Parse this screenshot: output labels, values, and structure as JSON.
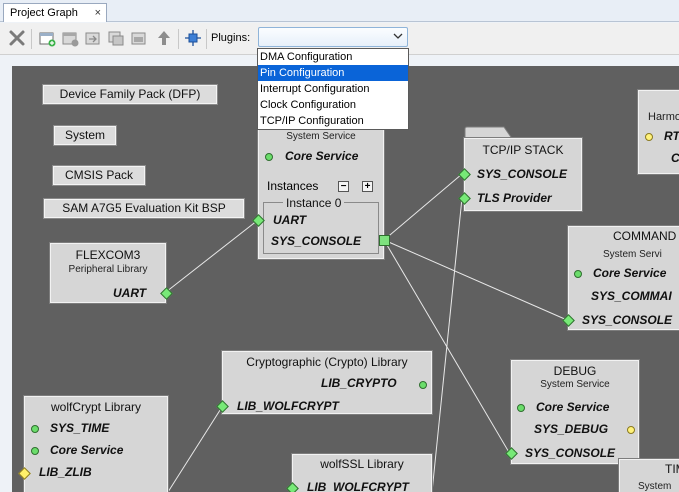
{
  "tab": {
    "title": "Project Graph",
    "close_glyph": "×"
  },
  "toolbar": {
    "plugins_label": "Plugins:",
    "plugins_value": "",
    "icons": [
      "delete-icon",
      "add-group-icon",
      "remove-group-icon",
      "move-to-group-icon",
      "copy-icon",
      "paste-icon",
      "move-up-icon",
      "auto-layout-icon"
    ]
  },
  "plugins_dropdown": {
    "options": [
      "DMA Configuration",
      "Pin Configuration",
      "Interrupt Configuration",
      "Clock Configuration",
      "TCP/IP Configuration"
    ],
    "selected_index": 1
  },
  "canvas": {
    "pills": [
      "Device Family Pack (DFP)",
      "System",
      "CMSIS Pack",
      "SAM A7G5 Evaluation Kit BSP"
    ],
    "core": {
      "subtitle": "System Service",
      "port_core": "Core Service",
      "instances_label": "Instances",
      "minus": "−",
      "plus": "+",
      "instance_label": "Instance 0",
      "port_uart": "UART",
      "port_console": "SYS_CONSOLE"
    },
    "flexcom": {
      "title": "FLEXCOM3",
      "subtitle": "Peripheral Library",
      "port": "UART"
    },
    "tcpip": {
      "title": "TCP/IP STACK",
      "port1": "SYS_CONSOLE",
      "port2": "TLS Provider"
    },
    "harmony": {
      "title": "Harmo",
      "port": "RT",
      "port2": "C"
    },
    "command": {
      "title": "COMMAND",
      "subtitle": "System Servi",
      "port1": "Core Service",
      "port2": "SYS_COMMAI",
      "port3": "SYS_CONSOLE"
    },
    "crypto": {
      "title": "Cryptographic (Crypto) Library",
      "port1": "LIB_CRYPTO",
      "port2": "LIB_WOLFCRYPT"
    },
    "debug": {
      "title": "DEBUG",
      "subtitle": "System Service",
      "port1": "Core Service",
      "port2": "SYS_DEBUG",
      "port3": "SYS_CONSOLE"
    },
    "wolfcrypt": {
      "title": "wolfCrypt Library",
      "port1": "SYS_TIME",
      "port2": "Core Service",
      "port3": "LIB_ZLIB"
    },
    "wolfssl": {
      "title": "wolfSSL Library",
      "port1": "LIB_WOLFCRYPT"
    },
    "tim": {
      "title": "TIM",
      "subtitle": "System"
    }
  }
}
